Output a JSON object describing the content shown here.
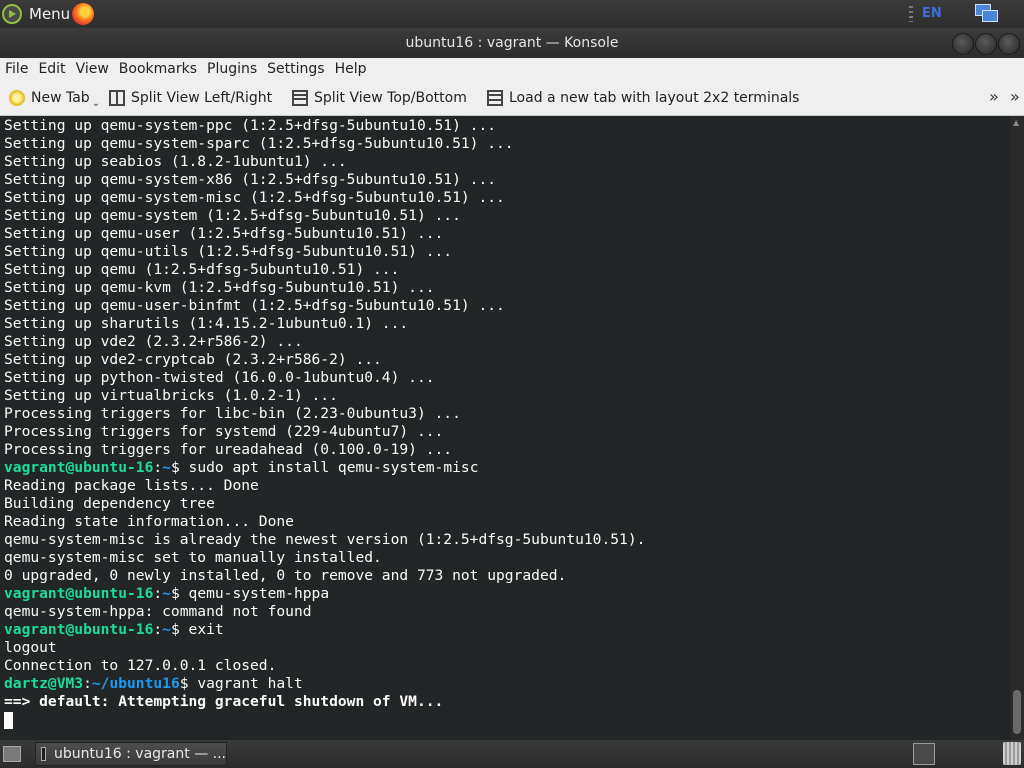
{
  "top_panel": {
    "menu_label": "Menu",
    "language": "EN"
  },
  "window": {
    "title": "ubuntu16 : vagrant — Konsole"
  },
  "menubar": {
    "items": [
      "File",
      "Edit",
      "View",
      "Bookmarks",
      "Plugins",
      "Settings",
      "Help"
    ]
  },
  "toolbar": {
    "new_tab": "New Tab",
    "split_lr": "Split View Left/Right",
    "split_tb": "Split View Top/Bottom",
    "layout_2x2": "Load a new tab with layout 2x2 terminals",
    "overflow": "»"
  },
  "terminal": {
    "lines": [
      [
        {
          "t": "Setting up qemu-system-ppc (1:2.5+dfsg-5ubuntu10.51) ..."
        }
      ],
      [
        {
          "t": "Setting up qemu-system-sparc (1:2.5+dfsg-5ubuntu10.51) ..."
        }
      ],
      [
        {
          "t": "Setting up seabios (1.8.2-1ubuntu1) ..."
        }
      ],
      [
        {
          "t": "Setting up qemu-system-x86 (1:2.5+dfsg-5ubuntu10.51) ..."
        }
      ],
      [
        {
          "t": "Setting up qemu-system-misc (1:2.5+dfsg-5ubuntu10.51) ..."
        }
      ],
      [
        {
          "t": "Setting up qemu-system (1:2.5+dfsg-5ubuntu10.51) ..."
        }
      ],
      [
        {
          "t": "Setting up qemu-user (1:2.5+dfsg-5ubuntu10.51) ..."
        }
      ],
      [
        {
          "t": "Setting up qemu-utils (1:2.5+dfsg-5ubuntu10.51) ..."
        }
      ],
      [
        {
          "t": "Setting up qemu (1:2.5+dfsg-5ubuntu10.51) ..."
        }
      ],
      [
        {
          "t": "Setting up qemu-kvm (1:2.5+dfsg-5ubuntu10.51) ..."
        }
      ],
      [
        {
          "t": "Setting up qemu-user-binfmt (1:2.5+dfsg-5ubuntu10.51) ..."
        }
      ],
      [
        {
          "t": "Setting up sharutils (1:4.15.2-1ubuntu0.1) ..."
        }
      ],
      [
        {
          "t": "Setting up vde2 (2.3.2+r586-2) ..."
        }
      ],
      [
        {
          "t": "Setting up vde2-cryptcab (2.3.2+r586-2) ..."
        }
      ],
      [
        {
          "t": "Setting up python-twisted (16.0.0-1ubuntu0.4) ..."
        }
      ],
      [
        {
          "t": "Setting up virtualbricks (1.0.2-1) ..."
        }
      ],
      [
        {
          "t": "Processing triggers for libc-bin (2.23-0ubuntu3) ..."
        }
      ],
      [
        {
          "t": "Processing triggers for systemd (229-4ubuntu7) ..."
        }
      ],
      [
        {
          "t": "Processing triggers for ureadahead (0.100.0-19) ..."
        }
      ],
      [
        {
          "t": "vagrant@ubuntu-16",
          "c": "pg"
        },
        {
          "t": ":"
        },
        {
          "t": "~",
          "c": "pb"
        },
        {
          "t": "$ sudo apt install qemu-system-misc"
        }
      ],
      [
        {
          "t": "Reading package lists... Done"
        }
      ],
      [
        {
          "t": "Building dependency tree"
        }
      ],
      [
        {
          "t": "Reading state information... Done"
        }
      ],
      [
        {
          "t": "qemu-system-misc is already the newest version (1:2.5+dfsg-5ubuntu10.51)."
        }
      ],
      [
        {
          "t": "qemu-system-misc set to manually installed."
        }
      ],
      [
        {
          "t": "0 upgraded, 0 newly installed, 0 to remove and 773 not upgraded."
        }
      ],
      [
        {
          "t": "vagrant@ubuntu-16",
          "c": "pg"
        },
        {
          "t": ":"
        },
        {
          "t": "~",
          "c": "pb"
        },
        {
          "t": "$ qemu-system-hppa"
        }
      ],
      [
        {
          "t": "qemu-system-hppa: command not found"
        }
      ],
      [
        {
          "t": "vagrant@ubuntu-16",
          "c": "pg"
        },
        {
          "t": ":"
        },
        {
          "t": "~",
          "c": "pb"
        },
        {
          "t": "$ exit"
        }
      ],
      [
        {
          "t": "logout"
        }
      ],
      [
        {
          "t": "Connection to 127.0.0.1 closed."
        }
      ],
      [
        {
          "t": "dartz@VM3",
          "c": "pg"
        },
        {
          "t": ":"
        },
        {
          "t": "~/ubuntu16",
          "c": "pb"
        },
        {
          "t": "$ vagrant halt"
        }
      ],
      [
        {
          "t": "==> default: Attempting graceful shutdown of VM...",
          "c": "bold"
        }
      ],
      [
        {
          "t": "",
          "cursor": true
        }
      ]
    ]
  },
  "taskbar": {
    "task_label": "ubuntu16 : vagrant — ..."
  },
  "colors": {
    "terminal_bg": "#232627",
    "terminal_fg": "#fcfcfc",
    "prompt_user": "#1cdc9a",
    "prompt_path": "#1d99f3"
  }
}
